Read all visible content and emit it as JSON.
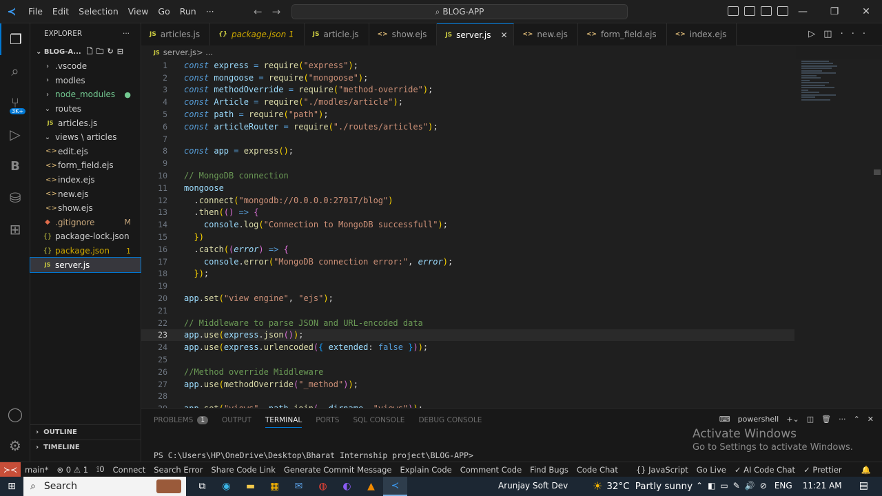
{
  "titlebar": {
    "menu": [
      "File",
      "Edit",
      "Selection",
      "View",
      "Go",
      "Run",
      "···"
    ],
    "search_text": "BLOG-APP"
  },
  "sidebar": {
    "title": "EXPLORER",
    "more": "···",
    "project": "BLOG-A...",
    "tree": [
      {
        "label": ".vscode",
        "icon": "chevron-right",
        "indent": 1,
        "color": "#cccccc"
      },
      {
        "label": "modles",
        "icon": "chevron-right",
        "indent": 1,
        "color": "#cccccc"
      },
      {
        "label": "node_modules",
        "icon": "chevron-right",
        "indent": 1,
        "color": "#73c991",
        "decoration": "●"
      },
      {
        "label": "routes",
        "icon": "chevron-down",
        "indent": 1,
        "color": "#cccccc"
      },
      {
        "label": "articles.js",
        "icon": "js",
        "indent": 2,
        "color": "#cccccc"
      },
      {
        "label": "views \\ articles",
        "icon": "chevron-down",
        "indent": 1,
        "color": "#cccccc"
      },
      {
        "label": "edit.ejs",
        "icon": "ejs",
        "indent": 2,
        "color": "#cccccc"
      },
      {
        "label": "form_field.ejs",
        "icon": "ejs",
        "indent": 2,
        "color": "#cccccc"
      },
      {
        "label": "index.ejs",
        "icon": "ejs",
        "indent": 2,
        "color": "#cccccc"
      },
      {
        "label": "new.ejs",
        "icon": "ejs",
        "indent": 2,
        "color": "#cccccc"
      },
      {
        "label": "show.ejs",
        "icon": "ejs",
        "indent": 2,
        "color": "#cccccc"
      },
      {
        "label": ".gitignore",
        "icon": "git",
        "indent": 1,
        "color": "#c5a57a",
        "decoration": "M"
      },
      {
        "label": "package-lock.json",
        "icon": "json",
        "indent": 1,
        "color": "#cccccc"
      },
      {
        "label": "package.json",
        "icon": "json",
        "indent": 1,
        "color": "#cca700",
        "decoration": "1"
      },
      {
        "label": "server.js",
        "icon": "js",
        "indent": 1,
        "color": "#ffffff",
        "selected": true
      }
    ],
    "outline": "OUTLINE",
    "timeline": "TIMELINE"
  },
  "tabs": [
    {
      "label": "articles.js",
      "icon": "JS",
      "icon_color": "#cbcb41"
    },
    {
      "label": "package.json 1",
      "icon": "{}",
      "icon_color": "#cbcb41",
      "modified": true
    },
    {
      "label": "article.js",
      "icon": "JS",
      "icon_color": "#cbcb41"
    },
    {
      "label": "show.ejs",
      "icon": "<>",
      "icon_color": "#e5c07b"
    },
    {
      "label": "server.js",
      "icon": "JS",
      "icon_color": "#cbcb41",
      "active": true
    },
    {
      "label": "new.ejs",
      "icon": "<>",
      "icon_color": "#e5c07b"
    },
    {
      "label": "form_field.ejs",
      "icon": "<>",
      "icon_color": "#e5c07b"
    },
    {
      "label": "index.ejs",
      "icon": "<>",
      "icon_color": "#e5c07b"
    }
  ],
  "breadcrumb": {
    "icon": "JS",
    "file": "server.js",
    "rest": " > ..."
  },
  "editor": {
    "current_line": 23,
    "lines": [
      "const express = require(\"express\");",
      "const mongoose = require(\"mongoose\");",
      "const methodOverride = require(\"method-override\");",
      "const Article = require(\"./modles/article\");",
      "const path = require(\"path\");",
      "const articleRouter = require(\"./routes/articles\");",
      "",
      "const app = express();",
      "",
      "// MongoDB connection",
      "mongoose",
      "  .connect(\"mongodb://0.0.0.0:27017/blog\")",
      "  .then(() => {",
      "    console.log(\"Connection to MongoDB successfull\");",
      "  })",
      "  .catch((error) => {",
      "    console.error(\"MongoDB connection error:\", error);",
      "  });",
      "",
      "app.set(\"view engine\", \"ejs\");",
      "",
      "// Middleware to parse JSON and URL-encoded data",
      "app.use(express.json());",
      "app.use(express.urlencoded({ extended: false }));",
      "",
      "//Method override Middleware",
      "app.use(methodOverride(\"_method\"));",
      "",
      "app.set(\"views\", path.join(__dirname, \"views\"));"
    ]
  },
  "panel": {
    "tabs": [
      "PROBLEMS",
      "OUTPUT",
      "TERMINAL",
      "PORTS",
      "SQL CONSOLE",
      "DEBUG CONSOLE"
    ],
    "active_tab": "TERMINAL",
    "problems_count": "1",
    "shell": "powershell",
    "prompt": "PS C:\\Users\\HP\\OneDrive\\Desktop\\Bharat Internship project\\BLOG-APP>"
  },
  "watermark": {
    "line1": "Activate Windows",
    "line2": "Go to Settings to activate Windows."
  },
  "statusbar": {
    "items": [
      "main*",
      "⊗ 0 ⚠ 1",
      "⟟0",
      "Connect",
      "Search Error",
      "Share Code Link",
      "Generate Commit Message",
      "Explain Code",
      "Comment Code",
      "Find Bugs",
      "Code Chat",
      "{} JavaScript",
      "Go Live",
      "✓ AI Code Chat",
      "✓ Prettier"
    ]
  },
  "taskbar": {
    "search": "Search",
    "user": "Arunjay Soft Dev",
    "temperature": "32°C",
    "weather": "Partly sunny",
    "language": "ENG",
    "time": "11:21 AM"
  },
  "activitybar": {
    "extensions_badge": "3K+"
  }
}
